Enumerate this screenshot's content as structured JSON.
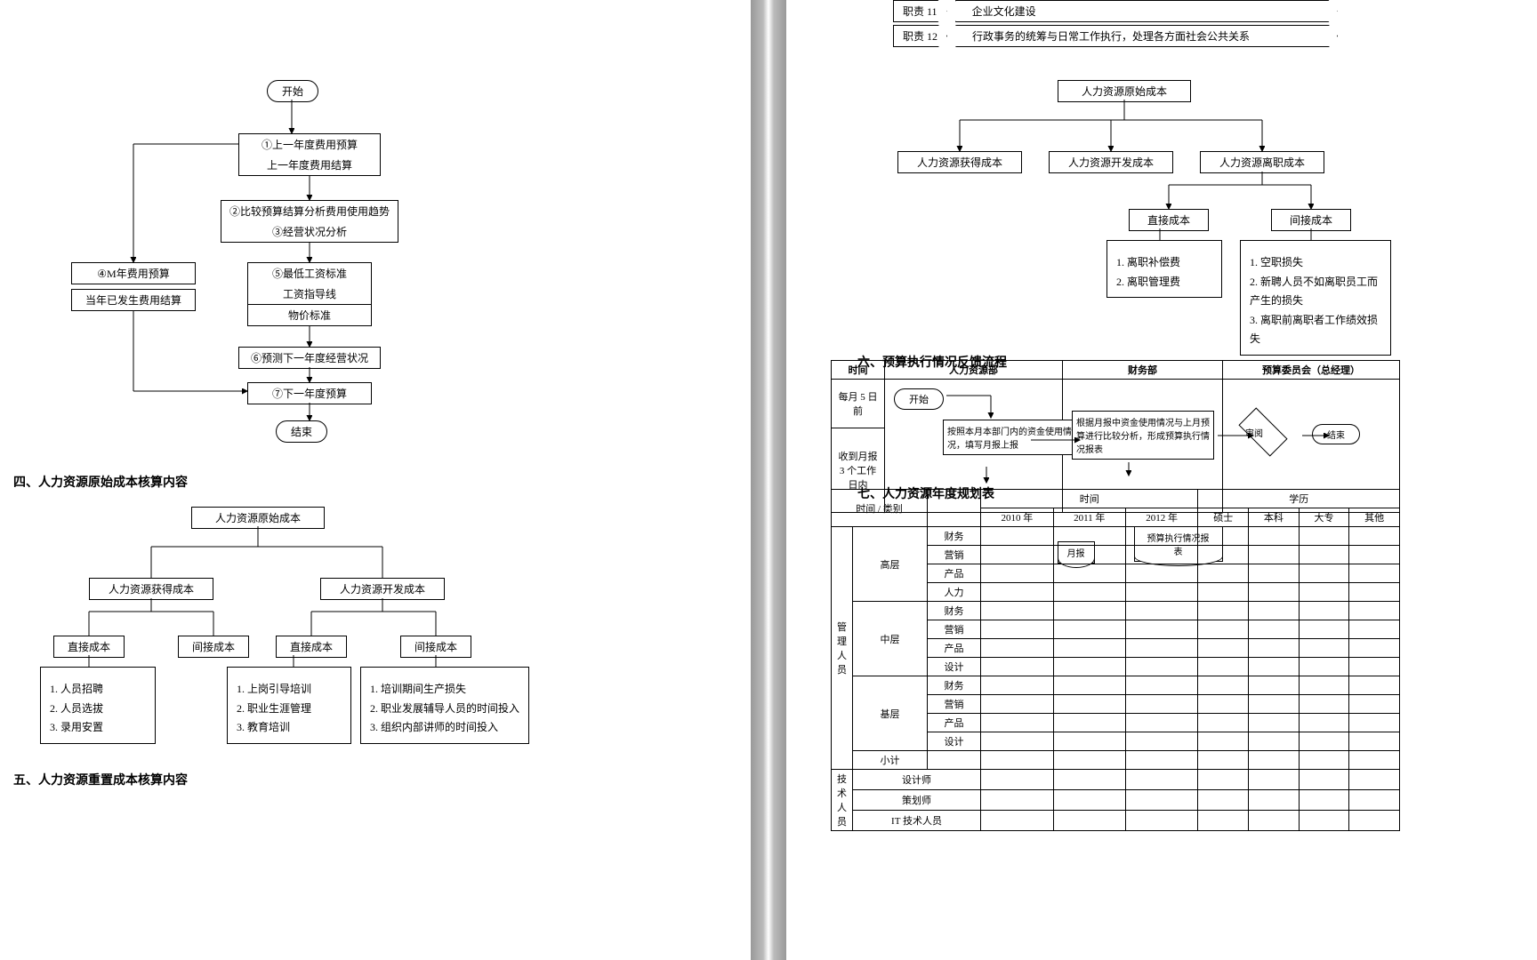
{
  "left": {
    "flow": {
      "start": "开始",
      "b1a": "①上一年度费用预算",
      "b1b": "上一年度费用结算",
      "b2a": "②比较预算结算分析费用使用趋势",
      "b2b": "③经营状况分析",
      "side_a": "④M年费用预算",
      "side_b": "当年已发生费用结算",
      "b3a": "⑤最低工资标准",
      "b3b": "工资指导线",
      "b3c": "物价标准",
      "b4": "⑥预测下一年度经营状况",
      "b5": "⑦下一年度预算",
      "end": "结束"
    },
    "heading4": "四、人力资源原始成本核算内容",
    "tree1": {
      "root": "人力资源原始成本",
      "n1": "人力资源获得成本",
      "n2": "人力资源开发成本",
      "l1": "直接成本",
      "l2": "间接成本",
      "l3": "直接成本",
      "l4": "间接成本",
      "note1_1": "1. 人员招聘",
      "note1_2": "2. 人员选拔",
      "note1_3": "3. 录用安置",
      "note2_1": "1. 上岗引导培训",
      "note2_2": "2. 职业生涯管理",
      "note2_3": "3. 教育培训",
      "note3_1": "1. 培训期间生产损失",
      "note3_2": "2. 职业发展辅导人员的时间投入",
      "note3_3": "3. 组织内部讲师的时间投入"
    },
    "heading5": "五、人力资源重置成本核算内容"
  },
  "right": {
    "chev11": "职责 11",
    "chev11_text": "企业文化建设",
    "chev12": "职责 12",
    "chev12_text": "行政事务的统筹与日常工作执行，处理各方面社会公共关系",
    "tree2": {
      "root": "人力资源原始成本",
      "n1": "人力资源获得成本",
      "n2": "人力资源开发成本",
      "n3": "人力资源离职成本",
      "l1": "直接成本",
      "l2": "间接成本",
      "note1_1": "1. 离职补偿费",
      "note1_2": "2. 离职管理费",
      "note2_1": "1. 空职损失",
      "note2_2": "2. 新聘人员不如离职员工而产生的损失",
      "note2_3": "3. 离职前离职者工作绩效损失"
    },
    "heading6": "六、预算执行情况反馈流程",
    "swim": {
      "h_time": "时间",
      "h_hr": "人力资源部",
      "h_fin": "财务部",
      "h_comm": "预算委员会（总经理）",
      "r1": "每月 5 日前",
      "r2": "收到月报 3 个工作日内",
      "start": "开始",
      "step1": "按照本月本部门内的资金使用情况，填写月报上报",
      "doc1": "月报",
      "step2": "根据月报中资金使用情况与上月预算进行比较分析，形成预算执行情况报表",
      "doc2": "预算执行情况报表",
      "decide": "审阅",
      "end": "结束"
    },
    "heading7": "七、人力资源年度规划表",
    "grid": {
      "h_main": "时间 / 类别",
      "h_time2": "时间",
      "h_edu": "学历",
      "y1": "2010 年",
      "y2": "2011 年",
      "y3": "2012 年",
      "e1": "硕士",
      "e2": "本科",
      "e3": "大专",
      "e4": "其他",
      "cat0": "管理人员",
      "lv1": "高层",
      "lv2": "中层",
      "lv3": "基层",
      "lv_sub": "小计",
      "d1": "财务",
      "d2": "营销",
      "d3": "产品",
      "d4": "人力",
      "d5": "财务",
      "d6": "营销",
      "d7": "产品",
      "d8": "设计",
      "d9": "财务",
      "d10": "营销",
      "d11": "产品",
      "d12": "设计",
      "cat2": "技术人员",
      "t1": "设计师",
      "t2": "策划师",
      "t3": "IT 技术人员"
    }
  }
}
